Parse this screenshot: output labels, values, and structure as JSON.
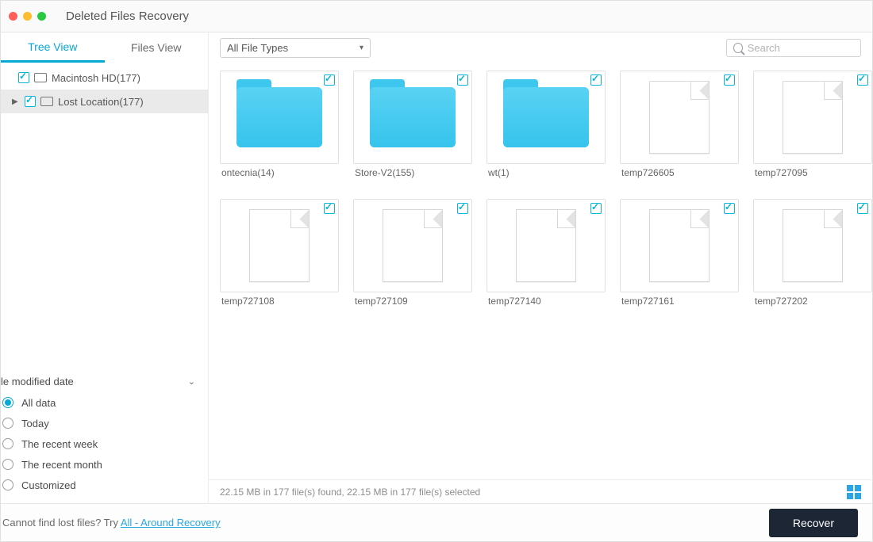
{
  "header": {
    "title": "Deleted Files Recovery"
  },
  "sidebar": {
    "tabs": {
      "tree": "Tree View",
      "files": "Files View"
    },
    "tree": [
      {
        "label": "Macintosh HD(177)"
      },
      {
        "label": "Lost Location(177)"
      }
    ]
  },
  "toolbar": {
    "filter_label": "All File Types",
    "search_placeholder": "Search"
  },
  "items": [
    {
      "type": "folder",
      "label": "ontecnia(14)"
    },
    {
      "type": "folder",
      "label": "Store-V2(155)"
    },
    {
      "type": "folder",
      "label": "wt(1)"
    },
    {
      "type": "file",
      "label": "temp726605"
    },
    {
      "type": "file",
      "label": "temp727095"
    },
    {
      "type": "file",
      "label": "temp727108"
    },
    {
      "type": "file",
      "label": "temp727109"
    },
    {
      "type": "file",
      "label": "temp727140"
    },
    {
      "type": "file",
      "label": "temp727161"
    },
    {
      "type": "file",
      "label": "temp727202"
    }
  ],
  "status": {
    "text": "22.15 MB in 177 file(s) found, 22.15 MB in 177 file(s) selected"
  },
  "filter": {
    "title": "le modified date",
    "options": [
      "All data",
      "Today",
      "The recent week",
      "The recent month",
      "Customized"
    ],
    "selected_index": 0
  },
  "footer": {
    "hint_prefix": "Cannot find lost files? Try ",
    "hint_link": "All - Around Recovery",
    "recover_label": "Recover"
  }
}
